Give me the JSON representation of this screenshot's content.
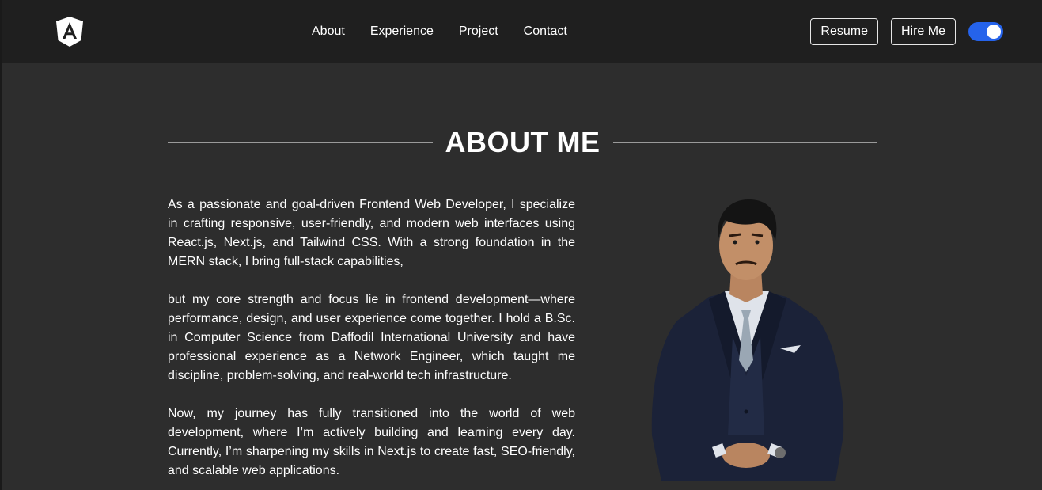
{
  "nav": {
    "logo_icon": "angular-logo-icon",
    "links": [
      "About",
      "Experience",
      "Project",
      "Contact"
    ],
    "resume_label": "Resume",
    "hire_label": "Hire Me",
    "theme_toggle_on": true,
    "accent_color": "#2563eb"
  },
  "about": {
    "title": "ABOUT ME",
    "paragraphs": [
      "As a passionate and goal-driven Frontend Web Developer, I specialize in crafting responsive, user-friendly, and modern web interfaces using React.js, Next.js, and Tailwind CSS. With a strong foundation in the MERN stack, I bring full-stack capabilities,",
      "but my core strength and focus lie in frontend development—where performance, design, and user experience come together. I hold a B.Sc. in Computer Science from Daffodil International University and have professional experience as a Network Engineer, which taught me discipline, problem-solving, and real-world tech infrastructure.",
      "Now, my journey has fully transitioned into the world of web development, where I’m actively building and learning every day. Currently, I’m sharpening my skills in Next.js to create fast, SEO-friendly, and scalable web applications."
    ],
    "portrait": "portrait-photo"
  }
}
